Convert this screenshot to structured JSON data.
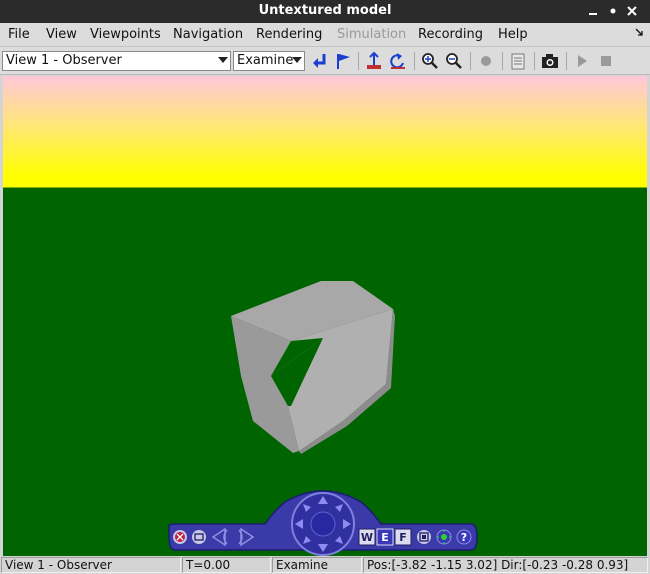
{
  "window": {
    "title": "Untextured model"
  },
  "menu": {
    "items": [
      {
        "label": "File"
      },
      {
        "label": "View"
      },
      {
        "label": "Viewpoints"
      },
      {
        "label": "Navigation"
      },
      {
        "label": "Rendering"
      },
      {
        "label": "Simulation",
        "disabled": true
      },
      {
        "label": "Recording"
      },
      {
        "label": "Help"
      }
    ]
  },
  "toolbar": {
    "view_select": "View 1 - Observer",
    "mode_select": "Examine",
    "icons": [
      "return-icon",
      "flag-icon",
      "straighten-icon",
      "undo-view-icon",
      "zoom-in-icon",
      "zoom-out-icon",
      "record-icon",
      "notes-icon",
      "camera-icon",
      "play-icon",
      "stop-icon"
    ]
  },
  "scene": {
    "sky_colors": [
      "#ffc7d8",
      "#ffff00"
    ],
    "ground_color": "#006400",
    "object": "grey polyhedron"
  },
  "navbar": {
    "icons": [
      "close-icon",
      "restore-icon",
      "arrow-left-icon",
      "arrow-right-icon",
      "dial-icon",
      "walk-icon",
      "examine-icon",
      "fly-icon",
      "fit-icon",
      "light-icon",
      "help-icon"
    ],
    "walk_label": "W",
    "examine_label": "E",
    "fly_label": "F",
    "help_label": "?"
  },
  "status": {
    "view": "View 1 - Observer",
    "time": "T=0.00",
    "mode": "Examine",
    "position": "Pos:[-3.82 -1.15 3.02] Dir:[-0.23 -0.28 0.93]"
  }
}
